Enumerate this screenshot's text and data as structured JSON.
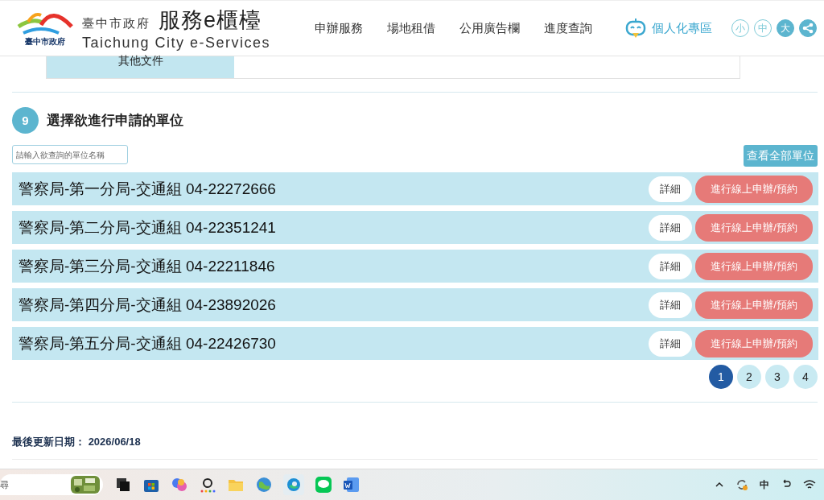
{
  "header": {
    "org_name": "臺中市政府",
    "site_title": "服務e櫃檯",
    "site_subtitle": "Taichung City e-Services",
    "logo_caption": "臺中市政府",
    "nav": [
      "申辦服務",
      "場地租借",
      "公用廣告欄",
      "進度查詢"
    ],
    "personal_link": "個人化專區",
    "font_sizes": [
      {
        "label": "小",
        "selected": false
      },
      {
        "label": "中",
        "selected": false
      },
      {
        "label": "大",
        "selected": true
      }
    ]
  },
  "document_tab": {
    "label": "其他文件"
  },
  "section": {
    "number": "9",
    "title": "選擇欲進行申請的單位"
  },
  "search": {
    "placeholder": "請輸入欲查詢的單位名稱"
  },
  "view_all_button": "查看全部單位",
  "units": [
    {
      "name": "警察局-第一分局-交通組 04-22272666",
      "details": "詳細",
      "apply": "進行線上申辦/預約"
    },
    {
      "name": "警察局-第二分局-交通組 04-22351241",
      "details": "詳細",
      "apply": "進行線上申辦/預約"
    },
    {
      "name": "警察局-第三分局-交通組 04-22211846",
      "details": "詳細",
      "apply": "進行線上申辦/預約"
    },
    {
      "name": "警察局-第四分局-交通組 04-23892026",
      "details": "詳細",
      "apply": "進行線上申辦/預約"
    },
    {
      "name": "警察局-第五分局-交通組 04-22426730",
      "details": "詳細",
      "apply": "進行線上申辦/預約"
    }
  ],
  "pagination": [
    {
      "label": "1",
      "selected": true
    },
    {
      "label": "2",
      "selected": false
    },
    {
      "label": "3",
      "selected": false
    },
    {
      "label": "4",
      "selected": false
    }
  ],
  "last_updated": {
    "label": "最後更新日期：",
    "value": "2026/06/18"
  },
  "taskbar": {
    "search_fragment": "尋",
    "ime": "中"
  }
}
